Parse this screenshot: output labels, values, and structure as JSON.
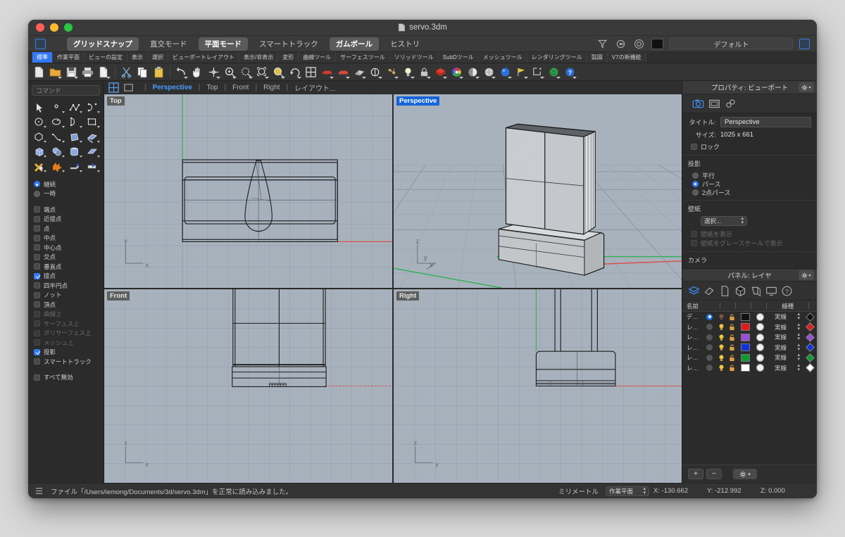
{
  "window": {
    "title": "servo.3dm",
    "doc_icon": "document-icon"
  },
  "modebar": {
    "buttons": [
      {
        "label": "グリッドスナップ",
        "on": true
      },
      {
        "label": "直交モード",
        "on": false
      },
      {
        "label": "平面モード",
        "on": true
      },
      {
        "label": "スマートトラック",
        "on": false
      },
      {
        "label": "ガムボール",
        "on": true
      },
      {
        "label": "ヒストリ",
        "on": false
      }
    ],
    "right_icons": [
      "filter-icon",
      "layer-target-icon",
      "layer-circle-icon"
    ],
    "current_layer_color": "#111111",
    "current_layer": "デフォルト"
  },
  "tabs": [
    {
      "label": "標準",
      "active": true
    },
    {
      "label": "作業平面",
      "active": false
    },
    {
      "label": "ビューの設定",
      "active": false
    },
    {
      "label": "表示",
      "active": false
    },
    {
      "label": "選択",
      "active": false
    },
    {
      "label": "ビューポートレイアウト",
      "active": false
    },
    {
      "label": "表示/非表示",
      "active": false
    },
    {
      "label": "変形",
      "active": false
    },
    {
      "label": "曲線ツール",
      "active": false
    },
    {
      "label": "サーフェスツール",
      "active": false
    },
    {
      "label": "ソリッドツール",
      "active": false
    },
    {
      "label": "SubDツール",
      "active": false
    },
    {
      "label": "メッシュツール",
      "active": false
    },
    {
      "label": "レンダリングツール",
      "active": false
    },
    {
      "label": "製図",
      "active": false
    },
    {
      "label": "V7の新機能",
      "active": false
    }
  ],
  "toolbar_icons": [
    "new-file-icon",
    "open-folder-icon",
    "save-icon",
    "print-icon",
    "copy-page-icon",
    "cut-scissors-icon",
    "copy-icon",
    "paste-icon",
    "undo-icon",
    "pan-hand-icon",
    "rotate-view-icon",
    "zoom-in-icon",
    "zoom-window-icon",
    "zoom-extents-icon",
    "zoom-selected-icon",
    "rotate-icon",
    "viewport-layout-icon",
    "render-car-icon",
    "render-preview-icon",
    "render-mesh-icon",
    "revolve-icon",
    "gumball-icon",
    "light-bulb-icon",
    "lock-icon",
    "material-icon",
    "color-wheel-icon",
    "shade-sphere-icon",
    "render-sphere-icon",
    "blue-sphere-icon",
    "flag-icon",
    "dimension-icon",
    "earth-icon",
    "help-icon"
  ],
  "sidebar": {
    "command_placeholder": "コマンド",
    "palette_icons": [
      "select-arrow-icon",
      "point-icon",
      "polyline-icon",
      "curve-icon",
      "circle-icon",
      "ellipse-icon",
      "arc-icon",
      "rectangle-icon",
      "polygon-icon",
      "freeform-curve-icon",
      "surface-patch-icon",
      "extrude-surface-icon",
      "box-solid-icon",
      "sphere-solid-icon",
      "cylinder-solid-icon",
      "plane-surface-icon",
      "boolean-icon",
      "explode-icon",
      "trim-icon",
      "split-icon"
    ],
    "osnap_modes": [
      {
        "label": "継続",
        "type": "radio",
        "on": true,
        "dim": false
      },
      {
        "label": "一時",
        "type": "radio",
        "on": false,
        "dim": false
      }
    ],
    "osnaps": [
      {
        "label": "端点",
        "on": false,
        "dim": false
      },
      {
        "label": "近接点",
        "on": false,
        "dim": false
      },
      {
        "label": "点",
        "on": false,
        "dim": false
      },
      {
        "label": "中点",
        "on": false,
        "dim": false
      },
      {
        "label": "中心点",
        "on": false,
        "dim": false
      },
      {
        "label": "交点",
        "on": false,
        "dim": false
      },
      {
        "label": "垂直点",
        "on": false,
        "dim": false
      },
      {
        "label": "接点",
        "on": true,
        "dim": false
      },
      {
        "label": "四半円点",
        "on": false,
        "dim": false
      },
      {
        "label": "ノット",
        "on": false,
        "dim": false
      },
      {
        "label": "頂点",
        "on": false,
        "dim": false
      },
      {
        "label": "曲線上",
        "on": false,
        "dim": true
      },
      {
        "label": "サーフェス上",
        "on": false,
        "dim": true
      },
      {
        "label": "ポリサーフェス上",
        "on": false,
        "dim": true
      },
      {
        "label": "メッシュ上",
        "on": false,
        "dim": true
      },
      {
        "label": "投影",
        "on": true,
        "dim": false
      },
      {
        "label": "スマートトラック",
        "on": false,
        "dim": false
      }
    ],
    "disable_all": {
      "label": "すべて無効",
      "on": false
    }
  },
  "viewtabs": {
    "layout_icon": "four-viewport-icon",
    "single_icon": "single-viewport-icon",
    "items": [
      {
        "label": "Perspective",
        "active": true
      },
      {
        "label": "Top",
        "active": false
      },
      {
        "label": "Front",
        "active": false
      },
      {
        "label": "Right",
        "active": false
      },
      {
        "label": "レイアウト...",
        "active": false
      }
    ]
  },
  "viewports": [
    {
      "name": "Top",
      "active": false,
      "axes": [
        "y",
        "x"
      ]
    },
    {
      "name": "Perspective",
      "active": true,
      "axes": [
        "z",
        "y",
        "x"
      ]
    },
    {
      "name": "Front",
      "active": false,
      "axes": [
        "z",
        "x"
      ]
    },
    {
      "name": "Right",
      "active": false,
      "axes": [
        "z",
        "y"
      ]
    }
  ],
  "properties": {
    "header": "プロパティ: ビューポート",
    "icons": [
      "camera-icon",
      "viewport-frame-icon",
      "link-icon"
    ],
    "title_label": "タイトル:",
    "title_value": "Perspective",
    "size_label": "サイズ:",
    "size_value": "1025 x 661",
    "lock_label": "ロック",
    "lock_on": false,
    "projection_title": "投影",
    "projection_options": [
      {
        "label": "平行",
        "on": false
      },
      {
        "label": "パース",
        "on": true
      },
      {
        "label": "2点パース",
        "on": false
      }
    ],
    "wallpaper_title": "壁紙",
    "wallpaper_select": "選択...",
    "wallpaper_show": "壁紙を表示",
    "wallpaper_gray": "壁紙をグレースケールで表示",
    "camera_title": "カメラ"
  },
  "layers": {
    "header": "パネル: レイヤ",
    "icons": [
      "layers-icon",
      "object-properties-icon",
      "document-icon",
      "box-icon",
      "display-icon",
      "monitor-icon",
      "help-icon"
    ],
    "col_name": "名前",
    "col_linetype": "線種",
    "rows": [
      {
        "name": "デ…",
        "current": true,
        "visible_icon": "bulb-off-icon",
        "lock_icon": "unlock-icon",
        "color": "#111111",
        "print_color": "#efefef",
        "linetype": "実線",
        "material": "#111111"
      },
      {
        "name": "レ…",
        "current": false,
        "visible_icon": "bulb-on-icon",
        "lock_icon": "unlock-icon",
        "color": "#e01b1b",
        "print_color": "#efefef",
        "linetype": "実線",
        "material": "#e01b1b"
      },
      {
        "name": "レ…",
        "current": false,
        "visible_icon": "bulb-on-icon",
        "lock_icon": "unlock-icon",
        "color": "#9b4fd8",
        "print_color": "#efefef",
        "linetype": "実線",
        "material": "#9b4fd8"
      },
      {
        "name": "レ…",
        "current": false,
        "visible_icon": "bulb-on-icon",
        "lock_icon": "unlock-icon",
        "color": "#1133dd",
        "print_color": "#efefef",
        "linetype": "実線",
        "material": "#1133dd"
      },
      {
        "name": "レ…",
        "current": false,
        "visible_icon": "bulb-on-icon",
        "lock_icon": "unlock-icon",
        "color": "#0f9b33",
        "print_color": "#efefef",
        "linetype": "実線",
        "material": "#0f9b33"
      },
      {
        "name": "レ…",
        "current": false,
        "visible_icon": "bulb-on-icon",
        "lock_icon": "unlock-icon",
        "color": "#ffffff",
        "print_color": "#efefef",
        "linetype": "実線",
        "material": "#ffffff"
      }
    ],
    "footer": {
      "add": "+",
      "remove": "−",
      "gear": "gear-icon"
    }
  },
  "statusbar": {
    "menu_icon": "list-icon",
    "message": "ファイル「/Users/iemong/Documents/3d/servo.3dm」を正常に読み込みました。",
    "units": "ミリメートル",
    "cplane": "作業平面",
    "x": "X: -130.662",
    "y": "Y: -212.992",
    "z": "Z: 0.000"
  }
}
